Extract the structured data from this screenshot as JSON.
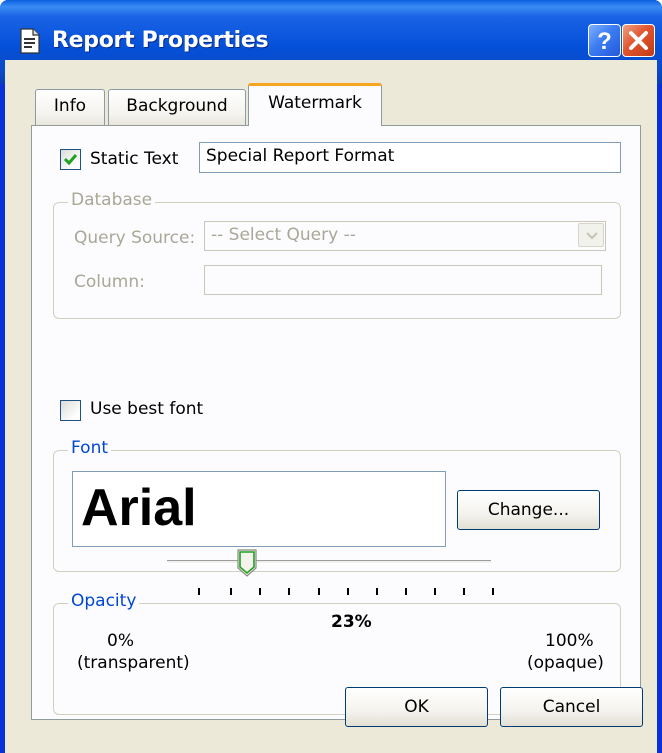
{
  "window": {
    "title": "Report Properties",
    "help_icon": "help-icon",
    "close_icon": "close-icon"
  },
  "tabs": [
    {
      "label": "Info",
      "selected": false
    },
    {
      "label": "Background",
      "selected": false
    },
    {
      "label": "Watermark",
      "selected": true
    }
  ],
  "static_text": {
    "label": "Static Text",
    "checked": true,
    "value": "Special Report Format"
  },
  "database": {
    "group_label": "Database",
    "query_source_label": "Query Source:",
    "query_source_value": "-- Select Query --",
    "column_label": "Column:",
    "column_value": ""
  },
  "use_best_font": {
    "label": "Use best font",
    "checked": false
  },
  "font": {
    "group_label": "Font",
    "preview": "Arial",
    "change_label": "Change..."
  },
  "opacity": {
    "group_label": "Opacity",
    "min_label": "0%",
    "min_sub": "(transparent)",
    "max_label": "100%",
    "max_sub": "(opaque)",
    "value_label": "23%",
    "value": 23
  },
  "buttons": {
    "ok": "OK",
    "cancel": "Cancel"
  },
  "colors": {
    "titlebar": "#0450d8",
    "accent_tab": "#f5a523",
    "group_title_blue": "#0046d5",
    "check_green": "#21a121"
  }
}
